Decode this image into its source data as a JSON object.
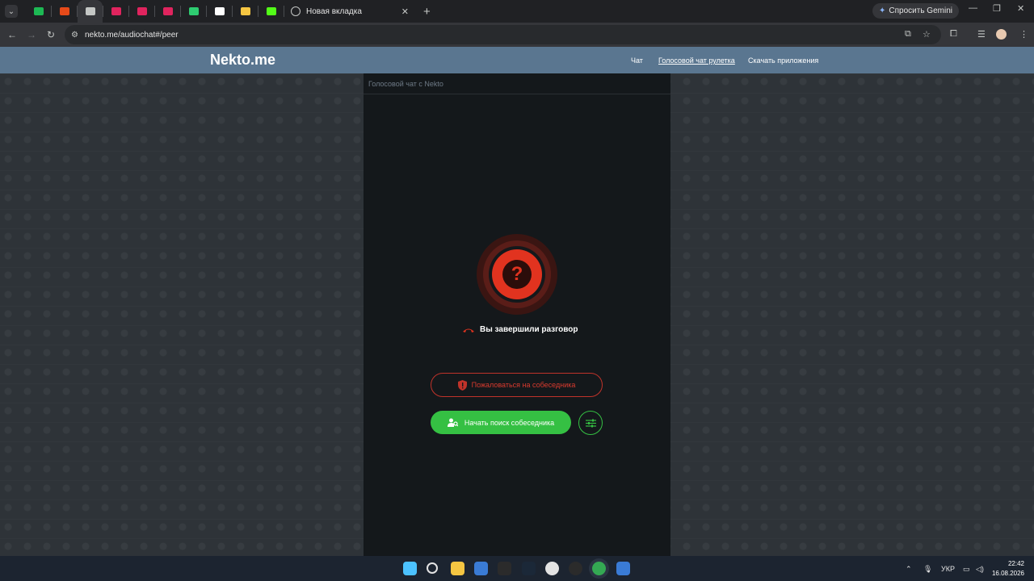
{
  "browser": {
    "active_tab_title": "Новая вкладка",
    "new_tab_glyph": "+",
    "gemini_label": "Спросить Gemini",
    "url": "nekto.me/audiochat#/peer",
    "pinned_tabs": [
      {
        "icon": "spotify-icon",
        "color": "#1db954"
      },
      {
        "icon": "orange-app-icon",
        "color": "#e64a19"
      },
      {
        "icon": "speaker-icon",
        "color": "#c4c7c5"
      },
      {
        "icon": "youtube-icon",
        "color": "#e0245e"
      },
      {
        "icon": "youtube-icon",
        "color": "#e0245e"
      },
      {
        "icon": "youtube-icon",
        "color": "#e0245e"
      },
      {
        "icon": "green-app-icon",
        "color": "#2ecc71"
      },
      {
        "icon": "tiktok-icon",
        "color": "#ffffff"
      },
      {
        "icon": "bar-chart-icon",
        "color": "#f5c542"
      },
      {
        "icon": "kick-icon",
        "color": "#53fc18"
      }
    ]
  },
  "site": {
    "logo": "Nekto.me",
    "nav": [
      "Чат",
      "Голосовой чат рулетка",
      "Скачать приложения"
    ]
  },
  "panel": {
    "header": "Голосовой чат с Nekto",
    "question_mark": "?",
    "status": "Вы завершили разговор",
    "report_button": "Пожаловаться на собеседника",
    "search_button": "Начать поиск собеседника"
  },
  "taskbar": {
    "apps": [
      "windows-start-icon",
      "search-icon",
      "file-explorer-icon",
      "store-icon",
      "epic-games-icon",
      "steam-icon",
      "media-player-icon",
      "obs-icon",
      "chrome-icon",
      "roblox-icon"
    ],
    "language": "УКР",
    "time": "22:42",
    "date": "16.08.2026"
  },
  "colors": {
    "header_bg": "#5a7690",
    "accent_green": "#35c043",
    "accent_red": "#e1331f"
  }
}
